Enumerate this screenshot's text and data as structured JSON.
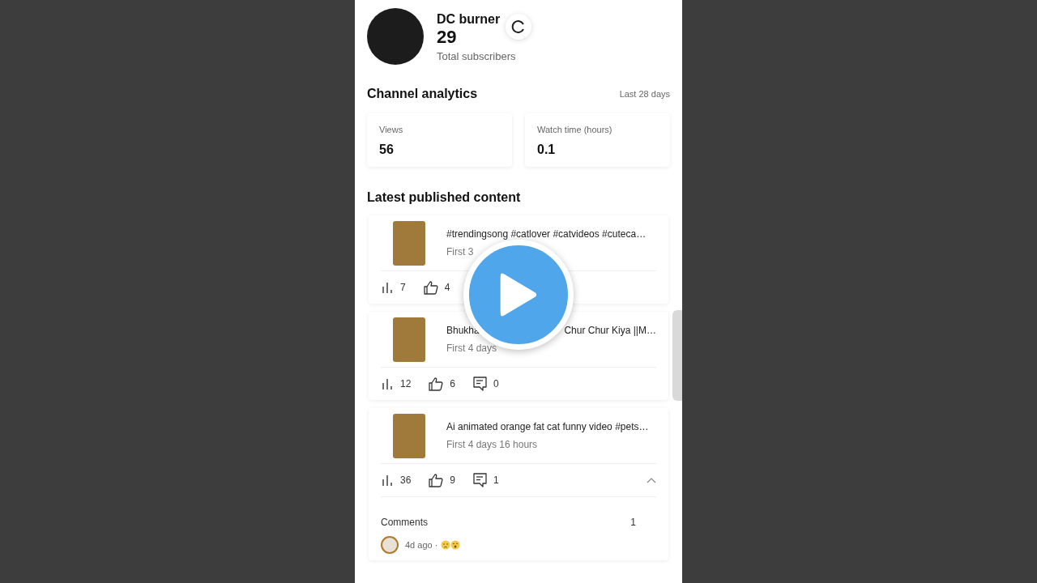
{
  "channel": {
    "name": "DC burner",
    "subscribers": "29",
    "subscribers_label": "Total subscribers"
  },
  "analytics": {
    "title": "Channel analytics",
    "period": "Last 28 days",
    "stats": [
      {
        "label": "Views",
        "value": "56"
      },
      {
        "label": "Watch time (hours)",
        "value": "0.1"
      }
    ]
  },
  "content": {
    "title": "Latest published content",
    "items": [
      {
        "title_parts": [
          "#trendingsong #catlover #catvideos #cuteca…"
        ],
        "meta": "First 3",
        "metrics": [
          {
            "kind": "views",
            "value": "7"
          },
          {
            "kind": "likes",
            "value": "4"
          }
        ],
        "expanded": false
      },
      {
        "title_parts": [
          "Bhukha",
          "Chur Chur Kiya ||M…"
        ],
        "meta": "First 4 days",
        "metrics": [
          {
            "kind": "views",
            "value": "12"
          },
          {
            "kind": "likes",
            "value": "6"
          },
          {
            "kind": "comments",
            "value": "0"
          }
        ],
        "expanded": false
      },
      {
        "title_parts": [
          "Ai animated orange fat cat funny video #pets…"
        ],
        "meta": "First 4 days 16 hours",
        "metrics": [
          {
            "kind": "views",
            "value": "36"
          },
          {
            "kind": "likes",
            "value": "9"
          },
          {
            "kind": "comments",
            "value": "1"
          }
        ],
        "expanded": true,
        "comments": {
          "label": "Comments",
          "count": "1",
          "time": "4d ago ·"
        }
      }
    ]
  }
}
